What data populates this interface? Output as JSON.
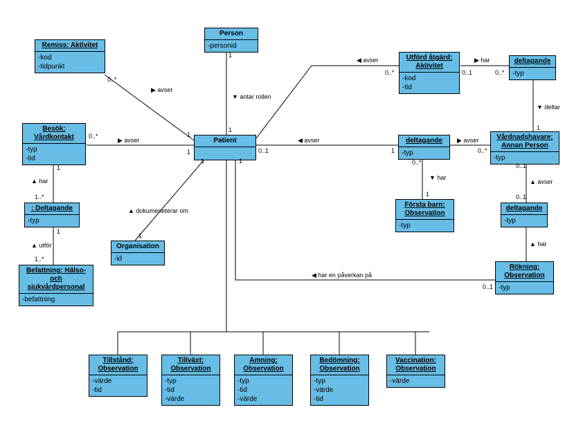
{
  "classes": {
    "remiss": {
      "title": "Remiss: Aktivitet",
      "attrs": [
        "-kod",
        "-tidpunkt"
      ]
    },
    "person": {
      "title": "Person",
      "attrs": [
        "-personid"
      ]
    },
    "utford": {
      "title": "Utförd åtgärd: Aktivitet",
      "attrs": [
        "-kod",
        "-tid"
      ]
    },
    "deltagande1": {
      "title": "deltagande",
      "attrs": [
        "-typ"
      ]
    },
    "besok": {
      "title": "Besök: Vårdkontakt",
      "attrs": [
        "-typ",
        "-tid"
      ]
    },
    "patient": {
      "title": "Patient",
      "attrs": [
        ""
      ]
    },
    "deltagande2": {
      "title": "deltagande",
      "attrs": [
        "-typ"
      ]
    },
    "vardnad": {
      "title": "Vårdnadshavare: Annan Person",
      "attrs": [
        "-typ"
      ]
    },
    "deltagande3": {
      "title": ": Deltagande",
      "attrs": [
        "-typ"
      ]
    },
    "forsta": {
      "title": "Första barn: Observation",
      "attrs": [
        "-typ"
      ]
    },
    "deltagande4": {
      "title": "deltagande",
      "attrs": [
        "-typ"
      ]
    },
    "organisation": {
      "title": "Organisation",
      "attrs": [
        "-id"
      ]
    },
    "rokning": {
      "title": "Rökning: Observation",
      "attrs": [
        "-typ"
      ]
    },
    "befattning": {
      "title": "Befattning: Hälso- och sjukvårdpersonal",
      "attrs": [
        "-befattning"
      ]
    },
    "tillstand": {
      "title": "Tillstånd: Observation",
      "attrs": [
        "-värde",
        "-tid"
      ]
    },
    "tillvaxt": {
      "title": "Tillväxt: Observation",
      "attrs": [
        "-typ",
        "-tid",
        "-värde"
      ]
    },
    "amning": {
      "title": "Amning: Observation",
      "attrs": [
        "-typ",
        "-tid",
        "-värde"
      ]
    },
    "bedomning": {
      "title": "Bedömning: Observation",
      "attrs": [
        "-typ",
        "-värde",
        "-tid"
      ]
    },
    "vaccination": {
      "title": "Vaccination: Observation",
      "attrs": [
        "-värde"
      ]
    }
  },
  "labels": {
    "avser1": "avser",
    "antar": "antar rollen",
    "avser2": "avser",
    "har1": "har",
    "avser3": "avser",
    "avser4": "avser",
    "deltar": "deltar",
    "avser5": "avser",
    "har2": "har",
    "har3": "har",
    "dokument": "dokumeneterar om",
    "utfor": "utför",
    "avser6": "avser",
    "har4": "har",
    "harpav": "har en påverkan på",
    "m01": "0..1",
    "m0s": "0..*",
    "m1": "1",
    "m1s": "1..*"
  },
  "chart_data": {
    "type": "uml_class_diagram",
    "classes": [
      {
        "name": "Remiss: Aktivitet",
        "attrs": [
          "kod",
          "tidpunkt"
        ]
      },
      {
        "name": "Person",
        "attrs": [
          "personid"
        ]
      },
      {
        "name": "Utförd åtgärd: Aktivitet",
        "attrs": [
          "kod",
          "tid"
        ]
      },
      {
        "name": "deltagande",
        "attrs": [
          "typ"
        ]
      },
      {
        "name": "Besök: Vårdkontakt",
        "attrs": [
          "typ",
          "tid"
        ]
      },
      {
        "name": "Patient",
        "attrs": []
      },
      {
        "name": "Vårdnadshavare: Annan Person",
        "attrs": [
          "typ"
        ]
      },
      {
        "name": ": Deltagande",
        "attrs": [
          "typ"
        ]
      },
      {
        "name": "Första barn: Observation",
        "attrs": [
          "typ"
        ]
      },
      {
        "name": "Organisation",
        "attrs": [
          "id"
        ]
      },
      {
        "name": "Rökning: Observation",
        "attrs": [
          "typ"
        ]
      },
      {
        "name": "Befattning: Hälso- och sjukvårdpersonal",
        "attrs": [
          "befattning"
        ]
      },
      {
        "name": "Tillstånd: Observation",
        "attrs": [
          "värde",
          "tid"
        ]
      },
      {
        "name": "Tillväxt: Observation",
        "attrs": [
          "typ",
          "tid",
          "värde"
        ]
      },
      {
        "name": "Amning: Observation",
        "attrs": [
          "typ",
          "tid",
          "värde"
        ]
      },
      {
        "name": "Bedömning: Observation",
        "attrs": [
          "typ",
          "värde",
          "tid"
        ]
      },
      {
        "name": "Vaccination: Observation",
        "attrs": [
          "värde"
        ]
      }
    ],
    "relationships": [
      {
        "from": "Remiss: Aktivitet",
        "to": "Patient",
        "label": "avser",
        "from_mult": "0..*",
        "to_mult": "1"
      },
      {
        "from": "Person",
        "to": "Patient",
        "label": "antar rollen",
        "from_mult": "1",
        "to_mult": "1"
      },
      {
        "from": "Utförd åtgärd: Aktivitet",
        "to": "Patient",
        "label": "avser",
        "from_mult": "0..*",
        "to_mult": "1"
      },
      {
        "from": "Utförd åtgärd: Aktivitet",
        "to": "deltagande",
        "label": "har",
        "from_mult": "0..1",
        "to_mult": "0..*"
      },
      {
        "from": "deltagande",
        "to": "Vårdnadshavare: Annan Person",
        "label": "deltar",
        "from_mult": "",
        "to_mult": "1"
      },
      {
        "from": "Besök: Vårdkontakt",
        "to": "Patient",
        "label": "avser",
        "from_mult": "0..*",
        "to_mult": "1"
      },
      {
        "from": "Besök: Vårdkontakt",
        "to": ": Deltagande",
        "label": "har",
        "from_mult": "1",
        "to_mult": "1..*"
      },
      {
        "from": ": Deltagande",
        "to": "Befattning: Hälso- och sjukvårdpersonal",
        "label": "utför",
        "from_mult": "1",
        "to_mult": "1..*"
      },
      {
        "from": "Organisation",
        "to": "Patient",
        "label": "dokumeneterar om",
        "from_mult": "1",
        "to_mult": "1"
      },
      {
        "from": "deltagande(2)",
        "to": "Patient",
        "label": "avser",
        "from_mult": "1",
        "to_mult": "0..1"
      },
      {
        "from": "deltagande(2)",
        "to": "Första barn: Observation",
        "label": "har",
        "from_mult": "0..*",
        "to_mult": "1"
      },
      {
        "from": "deltagande(2)",
        "to": "Vårdnadshavare: Annan Person",
        "label": "avser",
        "from_mult": "",
        "to_mult": "0..*"
      },
      {
        "from": "deltagande(3)",
        "to": "Vårdnadshavare: Annan Person",
        "label": "avser",
        "from_mult": "",
        "to_mult": "0..1"
      },
      {
        "from": "deltagande(3)",
        "to": "Rökning: Observation",
        "label": "har",
        "from_mult": "0..1",
        "to_mult": ""
      },
      {
        "from": "Rökning: Observation",
        "to": "Patient",
        "label": "har en påverkan på",
        "from_mult": "0..1",
        "to_mult": "1"
      },
      {
        "from": "Tillstånd: Observation",
        "to": "Patient",
        "type": "generalization"
      },
      {
        "from": "Tillväxt: Observation",
        "to": "Patient",
        "type": "generalization"
      },
      {
        "from": "Amning: Observation",
        "to": "Patient",
        "type": "generalization"
      },
      {
        "from": "Bedömning: Observation",
        "to": "Patient",
        "type": "generalization"
      },
      {
        "from": "Vaccination: Observation",
        "to": "Patient",
        "type": "generalization"
      }
    ]
  }
}
